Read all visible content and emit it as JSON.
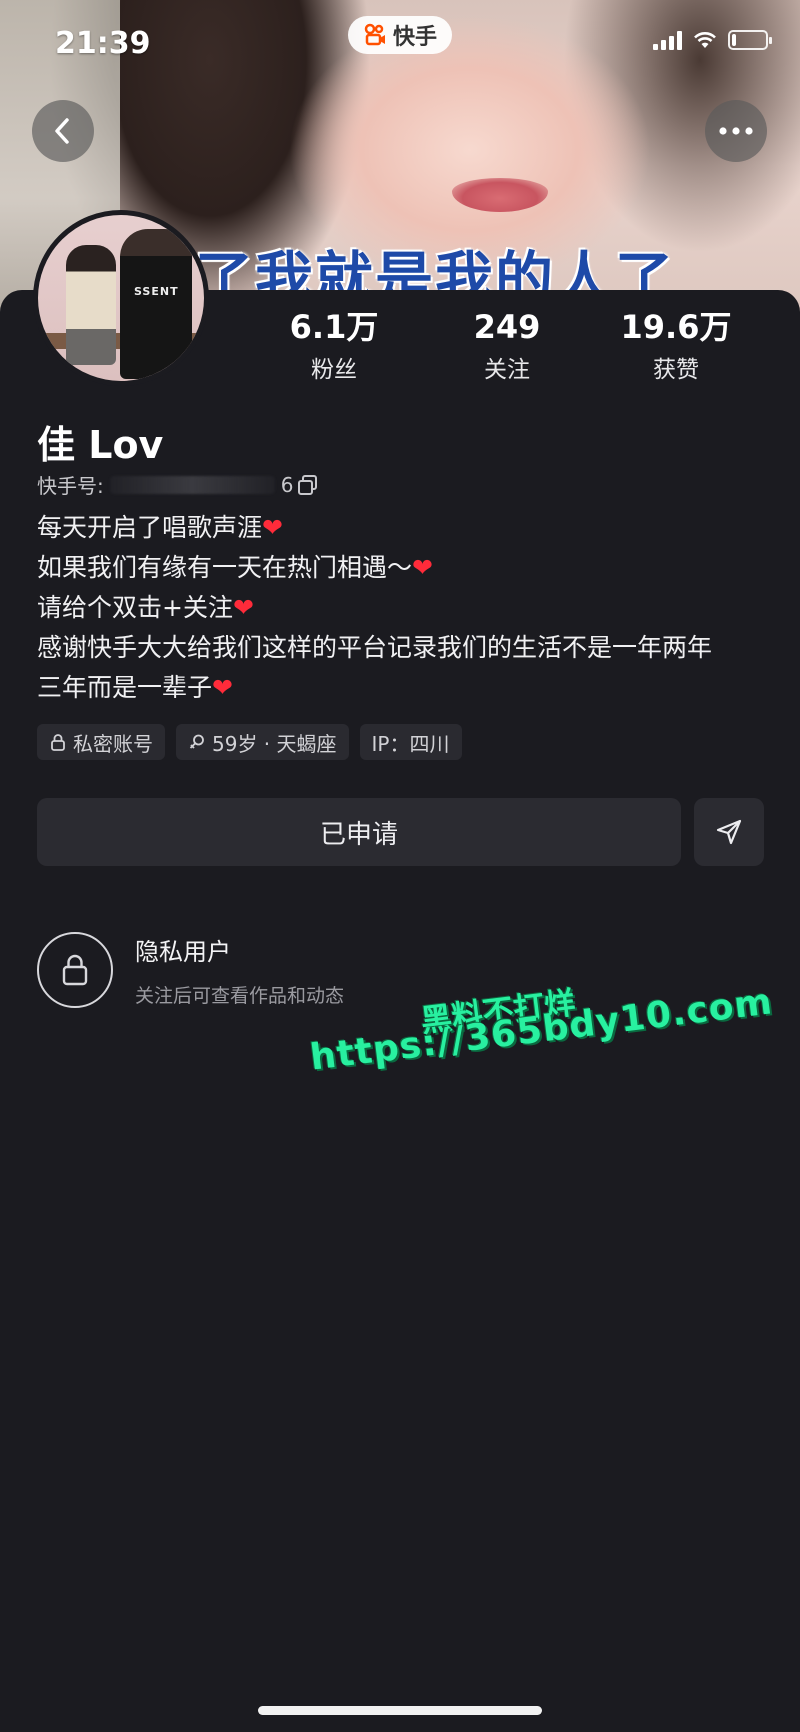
{
  "status_bar": {
    "time": "21:39",
    "app_name": "快手",
    "signal_level": 4,
    "battery_level": 0.1
  },
  "cover": {
    "caption": "了我就是我的人了"
  },
  "nav": {
    "back_icon": "chevron-left-icon",
    "more_icon": "more-dots-icon"
  },
  "profile": {
    "avatar_icon": "avatar-couple",
    "avatar_shirt_text": "SSENT",
    "name": "佳 Lov",
    "id_label": "快手号:",
    "id_suffix": "6",
    "stats": [
      {
        "value": "6.1万",
        "label": "粉丝"
      },
      {
        "value": "249",
        "label": "关注"
      },
      {
        "value": "19.6万",
        "label": "获赞"
      }
    ],
    "bio_lines": [
      "每天开启了唱歌声涯",
      "如果我们有缘有一天在热门相遇～",
      "请给个双击+关注",
      "感谢快手大大给我们这样的平台记录我们的生活不是一年两年",
      "三年而是一辈子"
    ],
    "heart": "❤",
    "tags": [
      {
        "text": "私密账号",
        "icon": "lock-icon"
      },
      {
        "text": "59岁 · 天蝎座",
        "icon": "female-icon"
      },
      {
        "text": "IP：四川",
        "icon": ""
      }
    ]
  },
  "actions": {
    "applied_label": "已申请",
    "send_icon": "send-icon"
  },
  "private_notice": {
    "title": "隐私用户",
    "subtitle": "关注后可查看作品和动态"
  },
  "watermark": {
    "line1": "黑料不打烊",
    "line2": "https://365bdy10.com"
  },
  "colors": {
    "background": "#1b1b20",
    "accent_heart": "#ff2b3a",
    "watermark": "#28f0a0",
    "kuaishou_orange": "#ff5000"
  }
}
